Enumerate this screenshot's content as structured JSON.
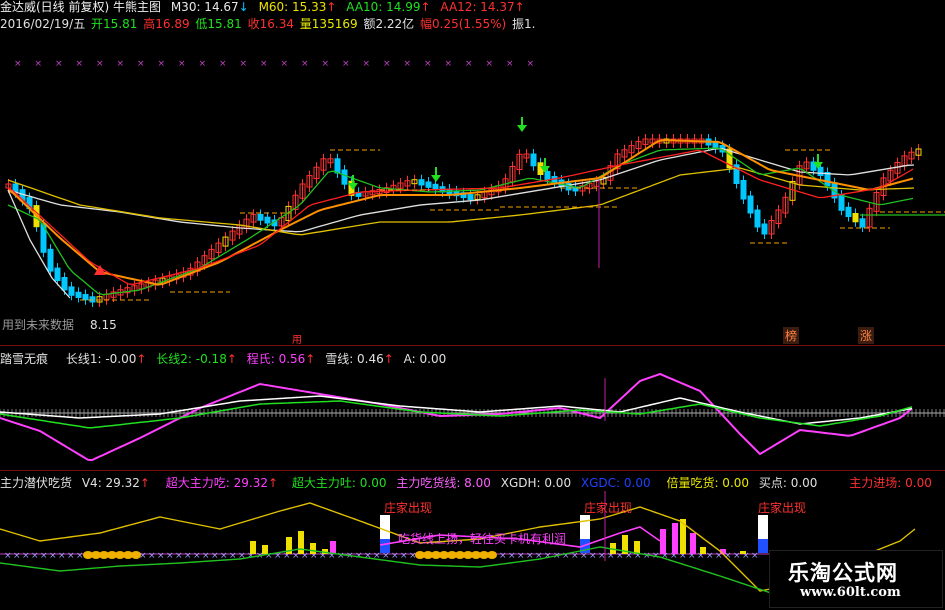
{
  "main_header": {
    "title": "金达威(日线 前复权) 牛熊主图",
    "m30": "M30: 14.67",
    "m30_arrow": "↓",
    "m60": "M60: 15.33",
    "m60_arrow": "↑",
    "aa10": "AA10: 14.99",
    "aa10_arrow": "↑",
    "aa12": "AA12: 14.37",
    "aa12_arrow": "↑"
  },
  "quote_line": {
    "date": "2016/02/19/五",
    "open": "开15.81",
    "high": "高16.89",
    "low": "低15.81",
    "close": "收16.34",
    "volume": "量135169",
    "amount": "额2.22亿",
    "change": "幅0.25(1.55%)",
    "amplitude": "振1."
  },
  "main_chart_labels": {
    "low_note": "用到未来数据",
    "low_price": "8.15",
    "top_tag": "榜",
    "rise_tag": "涨",
    "hidden_tag": "用"
  },
  "indicator2": {
    "name": "踏雪无痕",
    "long1": "长线1: -0.00",
    "long1_arrow": "↑",
    "long2": "长线2: -0.18",
    "long2_arrow": "↑",
    "cheng": "程氏: 0.56",
    "cheng_arrow": "↑",
    "snow": "雪线: 0.46",
    "snow_arrow": "↑",
    "a": "A: 0.00"
  },
  "indicator3": {
    "name": "主力潜伏吃货",
    "v4": "V4: 29.32",
    "v4_arrow": "↑",
    "super_eat": "超大主力吃: 29.32",
    "super_eat_arrow": "↑",
    "super_spit": "超大主力吐: 0.00",
    "eat_line": "主力吃货线: 8.00",
    "xgdh": "XGDH: 0.00",
    "xgdc": "XGDC: 0.00",
    "double_eat": "倍量吃货: 0.00",
    "buy_point": "买点: 0.00",
    "enter": "主力进场: 0.00",
    "annot_dealer1": "庄家出现",
    "annot_dealer2": "庄家出现",
    "annot_dealer3": "庄家出现",
    "annot_rise": "吃货线上扬，轻往买卡机有利润"
  },
  "watermark": {
    "name": "乐淘公式网",
    "url": "www.60lt.com"
  },
  "colors": {
    "up": "#ff3030",
    "down": "#00c8ff",
    "ma_white": "#e0e0e0",
    "ma_yellow": "#e0c000",
    "ma_green": "#20c020",
    "ma_orange": "#ff9000",
    "ma_red": "#ff2020",
    "magenta": "#ff40ff",
    "divider": "#7a1010"
  }
}
